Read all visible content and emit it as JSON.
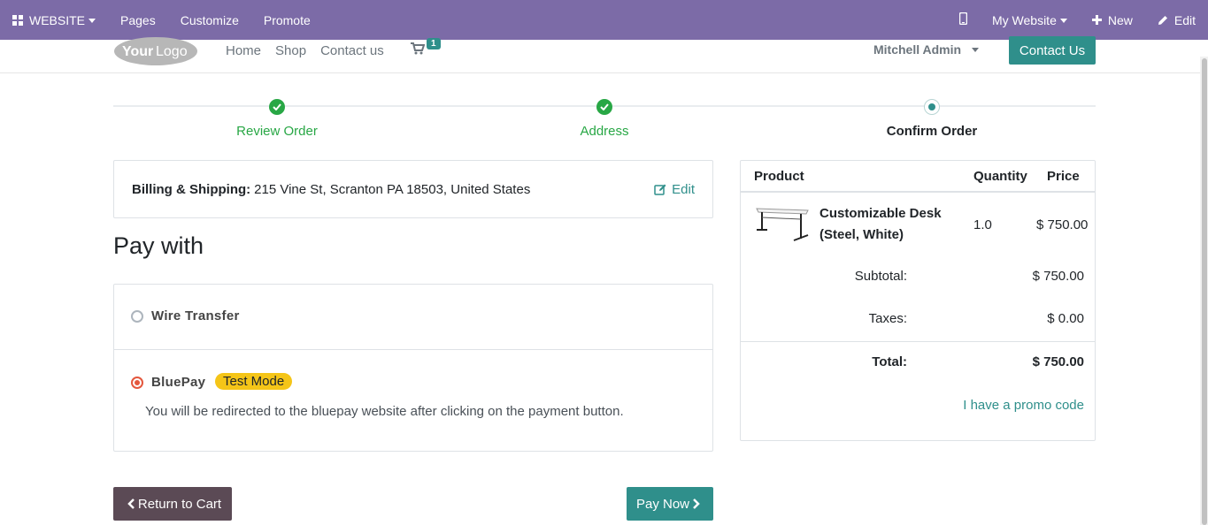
{
  "adminbar": {
    "website_menu": "WEBSITE",
    "pages": "Pages",
    "customize": "Customize",
    "promote": "Promote",
    "my_website": "My Website",
    "new": "New",
    "edit": "Edit"
  },
  "header": {
    "logo_text": "YourLogo",
    "nav": [
      "Home",
      "Shop",
      "Contact us"
    ],
    "cart_count": "1",
    "user": "Mitchell Admin",
    "contact_button": "Contact Us"
  },
  "steps": [
    {
      "label": "Review Order",
      "state": "done"
    },
    {
      "label": "Address",
      "state": "done"
    },
    {
      "label": "Confirm Order",
      "state": "active"
    }
  ],
  "billing": {
    "label": "Billing & Shipping:",
    "address": "215 Vine St, Scranton PA 18503, United States",
    "edit": "Edit"
  },
  "payment": {
    "title": "Pay with",
    "options": [
      {
        "name": "Wire Transfer",
        "selected": false
      },
      {
        "name": "BluePay",
        "badge": "Test Mode",
        "note": "You will be redirected to the bluepay website after clicking on the payment button.",
        "selected": true
      }
    ],
    "return_button": "Return to Cart",
    "pay_button": "Pay Now"
  },
  "summary": {
    "col_product": "Product",
    "col_quantity": "Quantity",
    "col_price": "Price",
    "product_name_line1": "Customizable Desk",
    "product_name_line2": "(Steel, White)",
    "quantity": "1.0",
    "price": "$ 750.00",
    "subtotal_label": "Subtotal:",
    "subtotal": "$ 750.00",
    "taxes_label": "Taxes:",
    "taxes": "$ 0.00",
    "total_label": "Total:",
    "total": "$ 750.00",
    "promo": "I have a promo code"
  },
  "colors": {
    "adminbar": "#7c6ba7",
    "primary": "#2f8f8b",
    "success": "#28a745",
    "secondary_button": "#5b4a55",
    "badge": "#f5c518"
  }
}
